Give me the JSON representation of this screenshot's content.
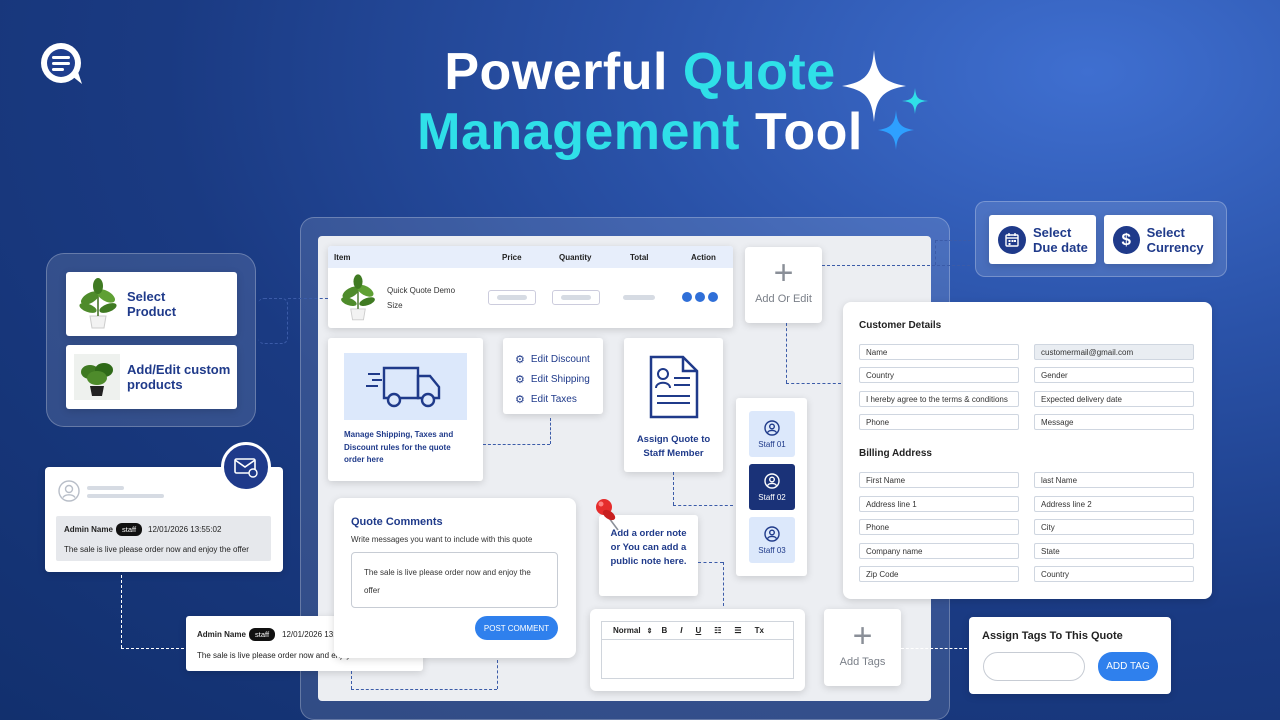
{
  "header": {
    "title_line1_a": "Powerful",
    "title_line1_b": "Quote",
    "title_line2_a": "Management",
    "title_line2_b": "Tool"
  },
  "products": {
    "select_product": "Select Product",
    "custom_products": "Add/Edit custom products"
  },
  "table": {
    "headers": [
      "Item",
      "Price",
      "Quantity",
      "Total",
      "Action"
    ],
    "row_name": "Quick Quote Demo",
    "row_sub": "Size"
  },
  "add_edit": "Add Or Edit",
  "top_right": {
    "due_date": "Select Due date",
    "currency": "Select Currency"
  },
  "shipping": {
    "caption": "Manage Shipping, Taxes and Discount rules for the quote order here"
  },
  "edit_menu": [
    "Edit Discount",
    "Edit Shipping",
    "Edit Taxes"
  ],
  "assign_quote": "Assign Quote to Staff Member",
  "staff": [
    "Staff 01",
    "Staff 02",
    "Staff 03"
  ],
  "customer": {
    "title": "Customer Details",
    "fields_left": [
      "Name",
      "Country",
      "I hereby agree to the terms & conditions",
      "Phone"
    ],
    "fields_right": [
      "customermail@gmail.com",
      "Gender",
      "Expected delivery date",
      "Message"
    ],
    "billing_title": "Billing Address",
    "billing_left": [
      "First Name",
      "Address line 1",
      "Phone",
      "Company name",
      "Zip Code"
    ],
    "billing_right": [
      "last Name",
      "Address line 2",
      "City",
      "State",
      "Country"
    ]
  },
  "notify": {
    "admin": "Admin Name",
    "badge": "staff",
    "time": "12/01/2026 13:55:02",
    "message": "The sale is live please order now and enjoy the offer"
  },
  "comments": {
    "title": "Quote Comments",
    "hint": "Write messages you want to include with this quote",
    "text": "The sale is live please order now and enjoy the offer",
    "button": "POST COMMENT"
  },
  "note": "Add a order note or You can add a public note here.",
  "editor": {
    "style": "Normal",
    "bold": "B",
    "italic": "I",
    "underline": "U",
    "ol": "☷",
    "ul": "☰",
    "clear": "Tx"
  },
  "add_tags": "Add Tags",
  "tags": {
    "title": "Assign Tags To This Quote",
    "button": "ADD TAG"
  },
  "colors": {
    "accent": "#2fe0e8",
    "navy": "#1f3a8a",
    "button": "#2f80ed"
  }
}
